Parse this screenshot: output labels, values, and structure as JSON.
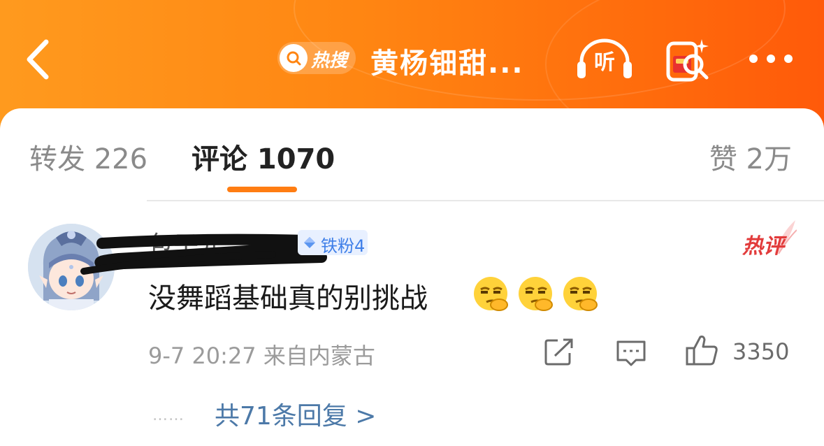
{
  "header": {
    "hot_search_label": "热搜",
    "title": "黄杨钿甜...",
    "listen_label": "听",
    "icons": [
      "back-icon",
      "search-icon",
      "headphones-icon",
      "red-packet-search-icon",
      "more-icon"
    ]
  },
  "tabs": {
    "repost": "转发 226",
    "comment": "评论 1070",
    "like": "赞 2万"
  },
  "comment": {
    "username": "包子元",
    "fan_badge": "铁粉4",
    "hot_label": "热评",
    "text": "没舞蹈基础真的别挑战",
    "emojis": [
      "thinking-face-emoji",
      "thinking-face-emoji",
      "thinking-face-emoji"
    ],
    "meta": "9-7 20:27  来自内蒙古",
    "like_count": "3350",
    "dots": "……",
    "replies_link": "共71条回复 >"
  },
  "colors": {
    "header_orange": "#ff8512",
    "tab_underline": "#ff7d12",
    "link_blue": "#4c79a8",
    "hot_red": "#e23b3b"
  }
}
